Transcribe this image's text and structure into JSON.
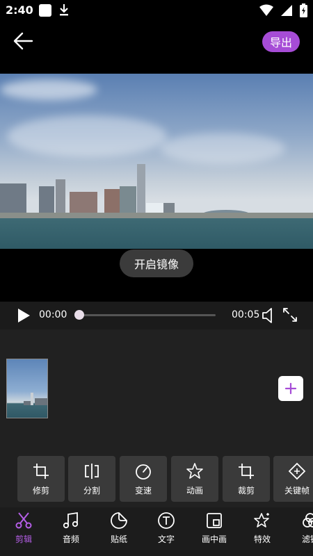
{
  "status_bar": {
    "time": "2:40"
  },
  "header": {
    "export_label": "导出"
  },
  "toast": {
    "text": "开启镜像"
  },
  "player": {
    "current_time": "00:00",
    "total_time": "00:05",
    "progress": 0.0
  },
  "tools": [
    {
      "label": "修剪",
      "icon": "trim-icon"
    },
    {
      "label": "分割",
      "icon": "split-icon"
    },
    {
      "label": "变速",
      "icon": "speed-icon"
    },
    {
      "label": "动画",
      "icon": "animation-icon"
    },
    {
      "label": "裁剪",
      "icon": "crop-icon"
    },
    {
      "label": "关键帧",
      "icon": "keyframe-icon"
    }
  ],
  "bottom_nav": [
    {
      "label": "剪辑",
      "icon": "scissors-icon",
      "active": true
    },
    {
      "label": "音频",
      "icon": "music-note-icon",
      "active": false
    },
    {
      "label": "贴纸",
      "icon": "sticker-icon",
      "active": false
    },
    {
      "label": "文字",
      "icon": "text-icon",
      "active": false
    },
    {
      "label": "画中画",
      "icon": "picture-in-picture-icon",
      "active": false
    },
    {
      "label": "特效",
      "icon": "effects-icon",
      "active": false
    },
    {
      "label": "滤镜",
      "icon": "filter-icon",
      "active": false
    }
  ],
  "colors": {
    "accent": "#a64cd6",
    "active_tab": "#b45ee6",
    "panel": "#212121",
    "tool_bg": "#3a3a3a"
  }
}
